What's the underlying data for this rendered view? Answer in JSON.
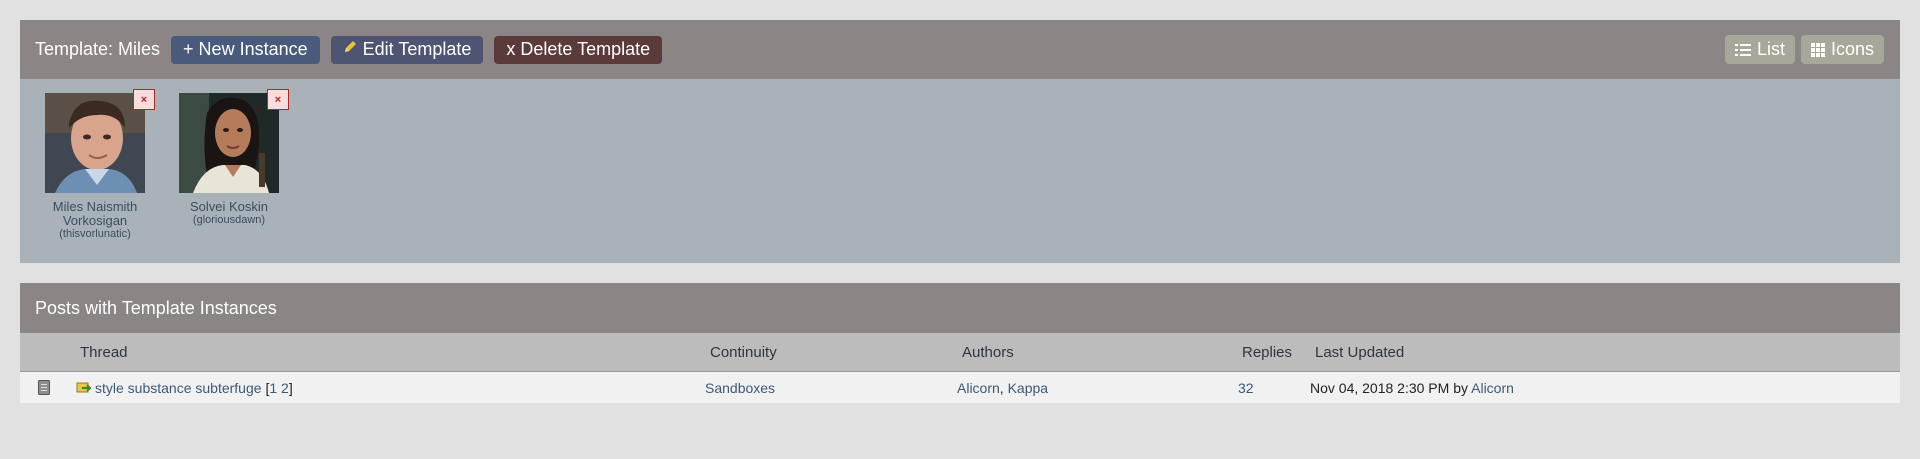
{
  "template": {
    "title": "Template: Miles",
    "buttons": {
      "new_instance": "+ New Instance",
      "edit_template": "Edit Template",
      "delete_template": "x Delete Template"
    },
    "view": {
      "list": "List",
      "icons": "Icons"
    },
    "characters": [
      {
        "name": "Miles Naismith Vorkosigan",
        "handle": "(thisvorlunatic)",
        "remove_label": "×"
      },
      {
        "name": "Solvei Koskin",
        "handle": "(gloriousdawn)",
        "remove_label": "×"
      }
    ]
  },
  "posts": {
    "header": "Posts with Template Instances",
    "columns": {
      "thread": "Thread",
      "continuity": "Continuity",
      "authors": "Authors",
      "replies": "Replies",
      "last_updated": "Last Updated"
    },
    "rows": [
      {
        "thread_title": "style substance subterfuge",
        "page_open": "[",
        "page_1": "1",
        "page_2": "2",
        "page_close": "]",
        "continuity": "Sandboxes",
        "author_1": "Alicorn",
        "author_sep": ",",
        "author_2": "Kappa",
        "replies": "32",
        "last_updated": "Nov 04, 2018 2:30 PM by",
        "last_updated_by": "Alicorn"
      }
    ]
  },
  "colors": {
    "header_bg": "#8b8585",
    "body_bg": "#a8b2b8",
    "link": "#3b5978"
  },
  "icons": [
    "pencil-icon",
    "list-icon",
    "grid-icon",
    "thread-status-icon",
    "unread-icon"
  ]
}
